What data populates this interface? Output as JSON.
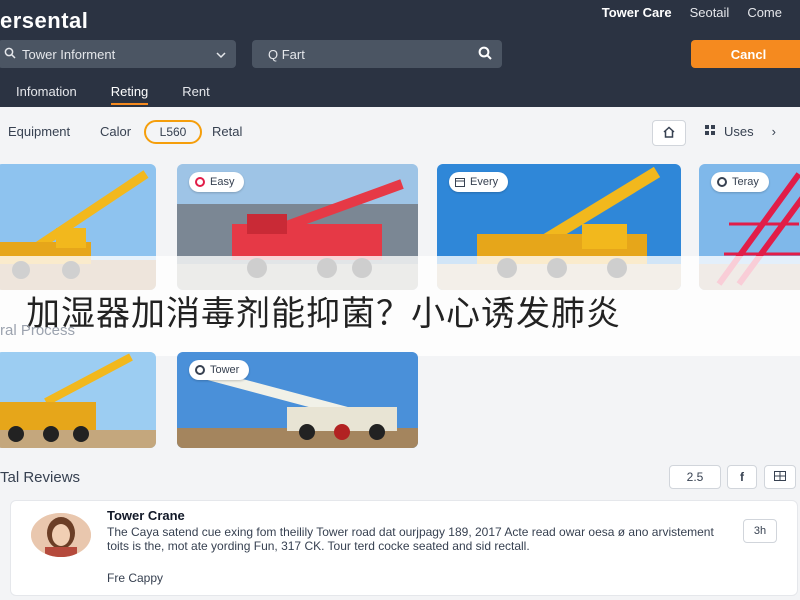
{
  "header": {
    "brand": "ersental",
    "links": [
      "Tower Care",
      "Seotail",
      "Come"
    ],
    "search_left": "Tower Informent",
    "search_right": "Q Fart",
    "cta": "Cancl"
  },
  "nav": {
    "items": [
      "Infomation",
      "Reting",
      "Rent"
    ],
    "active": "Reting"
  },
  "filters": {
    "equipment": "Equipment",
    "color": "Calor",
    "pill": "L560",
    "retail": "Retal",
    "uses": "Uses"
  },
  "cards": {
    "badges": [
      "Easy",
      "Every",
      "Teray",
      "Tower"
    ]
  },
  "banner": {
    "text": "加湿器加消毒剂能抑菌？小心诱发肺炎"
  },
  "section": {
    "process": "ral Process"
  },
  "reviews": {
    "title": "Tal Reviews",
    "count": "2.5",
    "name": "Tower Crane",
    "text": "The Caya satend cue exing fom theilily Tower road dat ourjpagy 189, 2017 Acte read owar oesa ø ano arvistement toits is the, mot ate yording Fun, 317 CK. Tour terd cocke seated and sid rectall.",
    "footer": "Fre Cappy",
    "side": "3h"
  }
}
